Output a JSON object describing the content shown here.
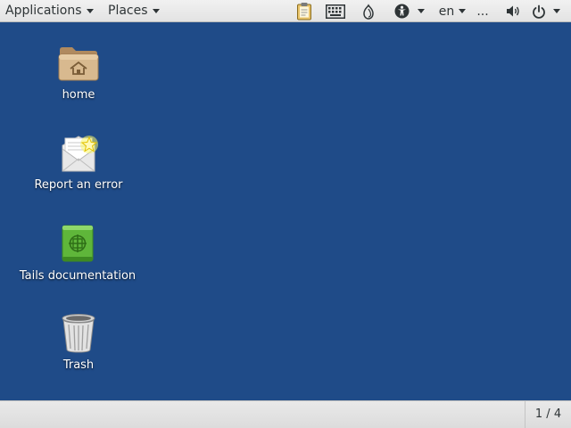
{
  "top_panel": {
    "applications_label": "Applications",
    "places_label": "Places",
    "language_label": "en",
    "overflow_label": "..."
  },
  "desktop": {
    "items": [
      {
        "label": "home",
        "icon": "folder-home-icon"
      },
      {
        "label": "Report an error",
        "icon": "report-error-icon"
      },
      {
        "label": "Tails documentation",
        "icon": "documentation-book-icon"
      },
      {
        "label": "Trash",
        "icon": "trash-icon"
      }
    ],
    "background_color": "#1f4b88"
  },
  "bottom_panel": {
    "workspace_label": "1 / 4"
  }
}
